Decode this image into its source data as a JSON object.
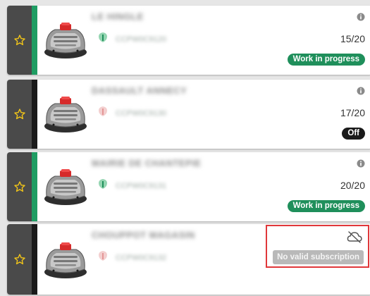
{
  "robots": [
    {
      "name": "LE HINGLE",
      "serial": "CCPW0C9120",
      "score": "15/20",
      "status": "Work in progress",
      "stripe_color": "#1f9d63",
      "signal": "green",
      "top_icon": "info-icon"
    },
    {
      "name": "DASSAULT ANNECY",
      "serial": "CCPW0C9130",
      "score": "17/20",
      "status": "Off",
      "stripe_color": "#1a1a1a",
      "signal": "red",
      "top_icon": "info-icon"
    },
    {
      "name": "MAIRIE DE CHANTEPIE",
      "serial": "CCPW0C9131",
      "score": "20/20",
      "status": "Work in progress",
      "stripe_color": "#1f9d63",
      "signal": "green",
      "top_icon": "info-icon"
    },
    {
      "name": "CHOUPPOT MAGASIN",
      "serial": "CCPW0C9132",
      "subscription_status": "No valid subscription",
      "stripe_color": "#1a1a1a",
      "signal": "red",
      "top_icon": "cloud-off-icon"
    }
  ],
  "colors": {
    "star": "#f0c419",
    "status_green": "#1f8f5b",
    "status_black": "#1a1a1a",
    "highlight_border": "#e0373a"
  }
}
